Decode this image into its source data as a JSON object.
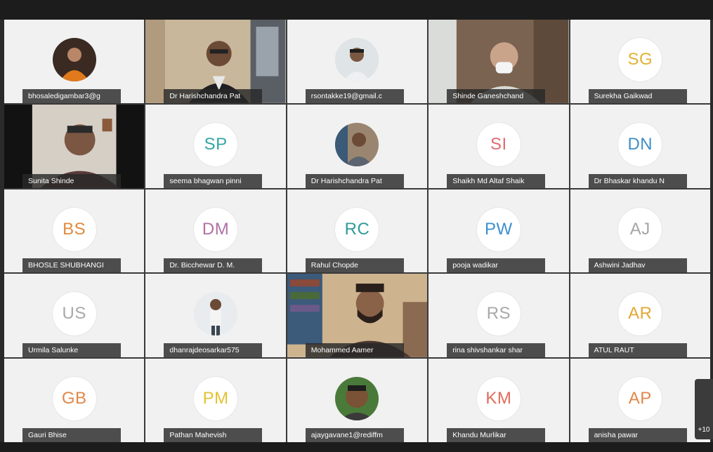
{
  "meeting": {
    "more_count": "+10",
    "participants": [
      {
        "name": "bhosaledigambar3@g",
        "type": "photo",
        "colors": {
          "bg": "#f3f3f3",
          "accent": "#e07a1c"
        }
      },
      {
        "name": "Dr Harishchandra Pat",
        "type": "video",
        "colors": {
          "bg": "#cbb89a"
        }
      },
      {
        "name": "rsontakke19@gmail.c",
        "type": "photo",
        "colors": {
          "bg": "#f3f3f3",
          "accent": "#bfc8cc"
        }
      },
      {
        "name": "Shinde Ganeshchand",
        "type": "video",
        "colors": {
          "bg": "#8a7360"
        }
      },
      {
        "name": "Surekha Gaikwad",
        "type": "initials",
        "initials": "SG",
        "colors": {
          "text": "#e2b233"
        }
      },
      {
        "name": "Sunita Shinde",
        "type": "video",
        "colors": {
          "bg": "#111111"
        }
      },
      {
        "name": "seema bhagwan pinni",
        "type": "initials",
        "initials": "SP",
        "colors": {
          "text": "#33a7a3"
        }
      },
      {
        "name": "Dr Harishchandra Pat",
        "type": "photo",
        "colors": {
          "bg": "#f3f3f3",
          "accent": "#7a6a58"
        }
      },
      {
        "name": "Shaikh Md Altaf Shaik",
        "type": "initials",
        "initials": "SI",
        "colors": {
          "text": "#e06b72"
        }
      },
      {
        "name": "Dr Bhaskar khandu N",
        "type": "initials",
        "initials": "DN",
        "colors": {
          "text": "#3e8fc5"
        }
      },
      {
        "name": "BHOSLE SHUBHANGI",
        "type": "initials",
        "initials": "BS",
        "colors": {
          "text": "#e08a3f"
        }
      },
      {
        "name": "Dr. Bicchewar D. M.",
        "type": "initials",
        "initials": "DM",
        "colors": {
          "text": "#b070a6"
        }
      },
      {
        "name": "Rahul Chopde",
        "type": "initials",
        "initials": "RC",
        "colors": {
          "text": "#2e9a9a"
        }
      },
      {
        "name": "pooja wadikar",
        "type": "initials",
        "initials": "PW",
        "colors": {
          "text": "#3b8fd0"
        }
      },
      {
        "name": "Ashwini Jadhav",
        "type": "initials",
        "initials": "AJ",
        "colors": {
          "text": "#a5a5a5"
        }
      },
      {
        "name": "Urmila Salunke",
        "type": "initials",
        "initials": "US",
        "colors": {
          "text": "#a9a9a9"
        }
      },
      {
        "name": "dhanrajdeosarkar575",
        "type": "photo",
        "colors": {
          "bg": "#f3f3f3",
          "accent": "#5a6570"
        }
      },
      {
        "name": "Mohammed Aamer",
        "type": "video",
        "colors": {
          "bg": "#6e5a44"
        }
      },
      {
        "name": "rina shivshankar shar",
        "type": "initials",
        "initials": "RS",
        "colors": {
          "text": "#a9a9a9"
        }
      },
      {
        "name": "ATUL RAUT",
        "type": "initials",
        "initials": "AR",
        "colors": {
          "text": "#e2a833"
        }
      },
      {
        "name": "Gauri Bhise",
        "type": "initials",
        "initials": "GB",
        "colors": {
          "text": "#e0884a"
        }
      },
      {
        "name": "Pathan Mahevish",
        "type": "initials",
        "initials": "PM",
        "colors": {
          "text": "#e2c233"
        }
      },
      {
        "name": "ajaygavane1@rediffm",
        "type": "photo",
        "colors": {
          "bg": "#f3f3f3",
          "accent": "#3a7a3a"
        }
      },
      {
        "name": "Khandu Murlikar",
        "type": "initials",
        "initials": "KM",
        "colors": {
          "text": "#e06b5a"
        }
      },
      {
        "name": "anisha pawar",
        "type": "initials",
        "initials": "AP",
        "colors": {
          "text": "#e0884a"
        }
      }
    ]
  }
}
